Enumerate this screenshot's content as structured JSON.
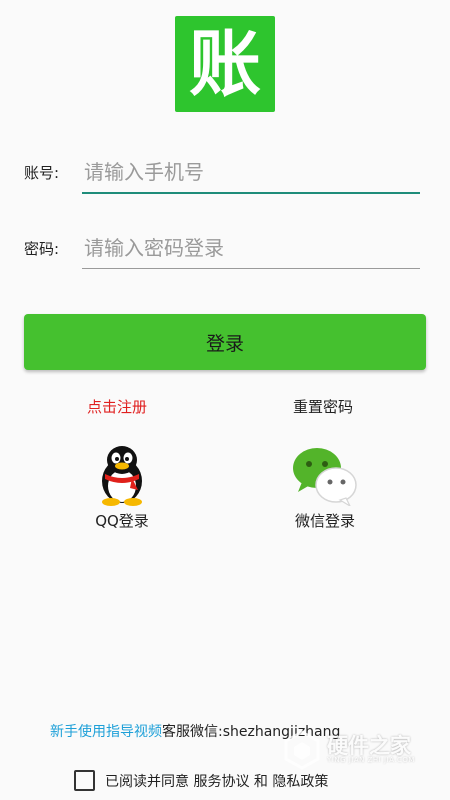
{
  "logo": {
    "text": "账"
  },
  "account": {
    "label": "账号:",
    "placeholder": "请输入手机号"
  },
  "password": {
    "label": "密码:",
    "placeholder": "请输入密码登录"
  },
  "login": {
    "label": "登录"
  },
  "links": {
    "register": "点击注册",
    "reset": "重置密码"
  },
  "social": {
    "qq": "QQ登录",
    "wechat": "微信登录"
  },
  "footer": {
    "guide": "新手使用指导视频",
    "service": "客服微信:shezhangjizhang",
    "agree_prefix": "已阅读并同意",
    "service_agreement": "服务协议",
    "and": "和",
    "privacy": "隐私政策"
  },
  "watermark": {
    "title": "硬件之家",
    "subtitle": "YING JIAN ZHI JIA.COM"
  },
  "colors": {
    "brand_green": "#45c12f",
    "register_red": "#e02020",
    "link_blue": "#1ea0d8",
    "input_focus": "#1e8c7a"
  }
}
